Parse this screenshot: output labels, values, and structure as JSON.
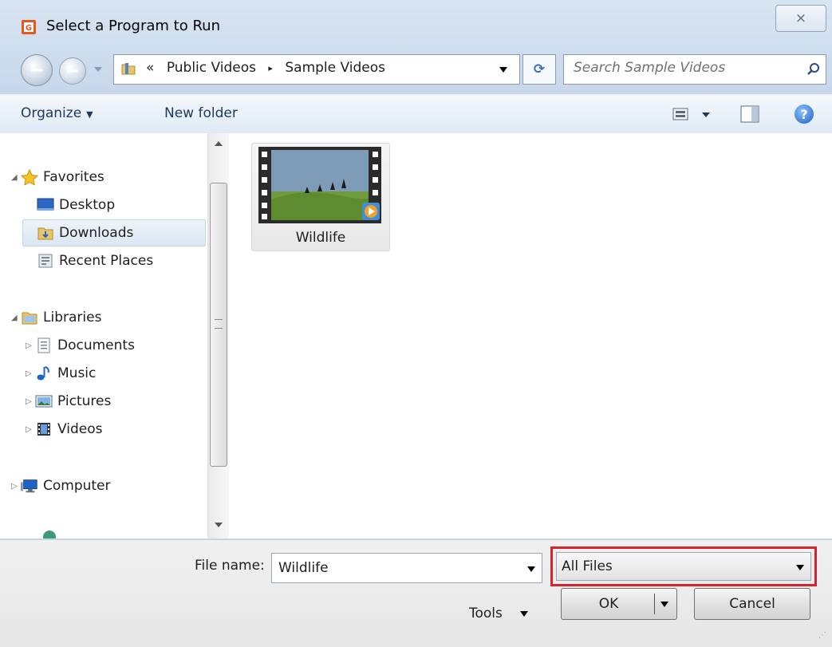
{
  "window": {
    "title": "Select a Program to Run",
    "close_label": "×"
  },
  "address": {
    "prefix": "«",
    "crumbs": [
      "Public Videos",
      "Sample Videos"
    ],
    "separator": "▸"
  },
  "search": {
    "placeholder": "Search Sample Videos"
  },
  "toolbar": {
    "organize_label": "Organize",
    "new_folder_label": "New folder",
    "help_label": "?"
  },
  "nav": {
    "favorites": {
      "label": "Favorites",
      "items": [
        "Desktop",
        "Downloads",
        "Recent Places"
      ],
      "selected": "Downloads"
    },
    "libraries": {
      "label": "Libraries",
      "items": [
        "Documents",
        "Music",
        "Pictures",
        "Videos"
      ]
    },
    "computer": {
      "label": "Computer"
    }
  },
  "files": [
    {
      "name": "Wildlife",
      "type": "video"
    }
  ],
  "footer": {
    "file_name_label": "File name:",
    "file_name_value": "Wildlife",
    "file_type_value": "All Files",
    "tools_label": "Tools",
    "ok_label": "OK",
    "cancel_label": "Cancel"
  },
  "colors": {
    "highlight_border": "#d2262c",
    "window_frame": "#c9d9ec",
    "selection": "#dbe6f3"
  }
}
